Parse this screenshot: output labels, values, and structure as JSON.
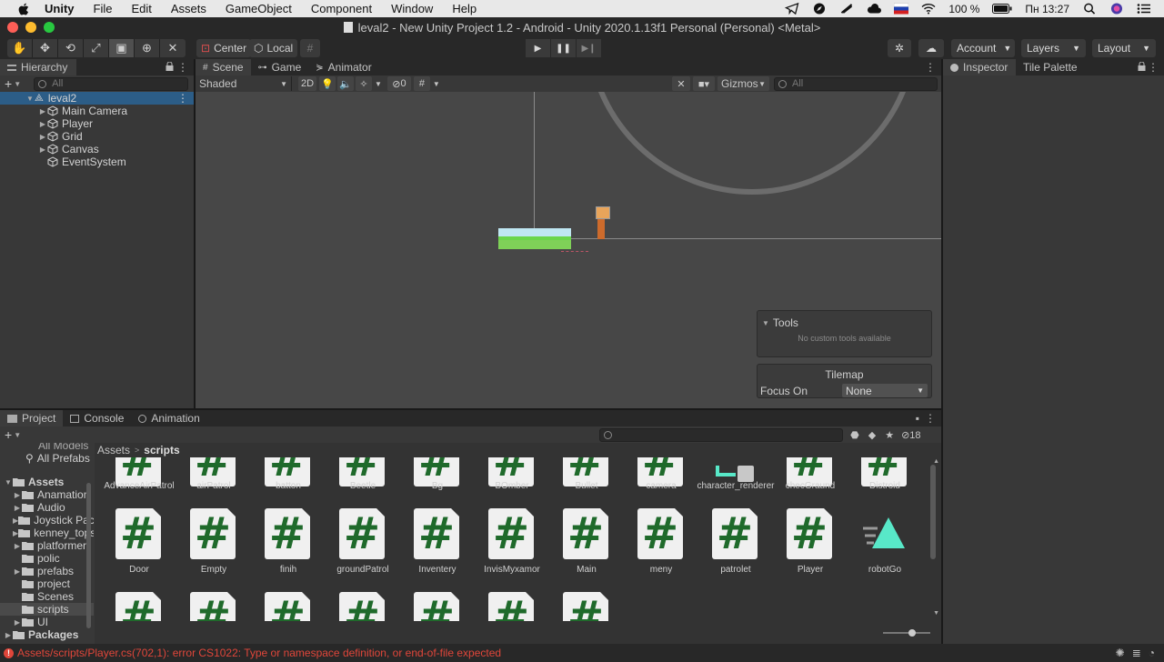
{
  "mac_menu": {
    "app": "Unity",
    "items": [
      "File",
      "Edit",
      "Assets",
      "GameObject",
      "Component",
      "Window",
      "Help"
    ],
    "battery": "100 %",
    "clock": "Пн 13:27"
  },
  "window": {
    "title": "leval2 - New Unity Project 1.2 - Android - Unity 2020.1.13f1 Personal (Personal) <Metal>"
  },
  "toolbar": {
    "pivot": "Center",
    "space": "Local",
    "account": "Account",
    "layers": "Layers",
    "layout": "Layout"
  },
  "hierarchy": {
    "tab": "Hierarchy",
    "search_placeholder": "All",
    "scene_name": "leval2",
    "objects": [
      "Main Camera",
      "Player",
      "Grid",
      "Canvas",
      "EventSystem"
    ]
  },
  "scene": {
    "tabs": [
      "Scene",
      "Game",
      "Animator"
    ],
    "shading": "Shaded",
    "mode_2d": "2D",
    "hidden_count": "0",
    "gizmos": "Gizmos",
    "search_placeholder": "All",
    "tools_panel": {
      "title": "Tools",
      "message": "No custom tools available"
    },
    "tilemap_panel": {
      "title": "Tilemap",
      "focus_label": "Focus On",
      "focus_value": "None"
    }
  },
  "inspector": {
    "tabs": [
      "Inspector",
      "Tile Palette"
    ]
  },
  "project": {
    "tabs": [
      "Project",
      "Console",
      "Animation"
    ],
    "hidden_count": "18",
    "favorites": [
      "All Models",
      "All Prefabs"
    ],
    "tree": {
      "root": "Assets",
      "folders": [
        "Anamation",
        "Audio",
        "Joystick Pack",
        "kenney_tops",
        "platformer",
        "polic",
        "prefabs",
        "project",
        "Scenes",
        "scripts",
        "UI"
      ],
      "packages": "Packages"
    },
    "breadcrumb": [
      "Assets",
      "scripts"
    ],
    "assets_row1": [
      "AdvanceAirPatrol",
      "airPatrol",
      "batton",
      "Beetle",
      "Bg",
      "BOmber",
      "Bullet",
      "camera",
      "character_renderer",
      "checGraund",
      "Distroid"
    ],
    "assets_row2": [
      "Door",
      "Empty",
      "finih",
      "groundPatrol",
      "Inventery",
      "InvisMyxamor",
      "Main",
      "meny",
      "patrolet",
      "Player",
      "robotGo"
    ],
    "assets_row3_count": 7
  },
  "status": {
    "error": "Assets/scripts/Player.cs(702,1): error CS1022: Type or namespace definition, or end-of-file expected"
  },
  "colors": {
    "selection": "#2c5d87",
    "error": "#e0463a",
    "script_hash": "#1f6a2b",
    "robot_icon": "#58e8c8"
  }
}
